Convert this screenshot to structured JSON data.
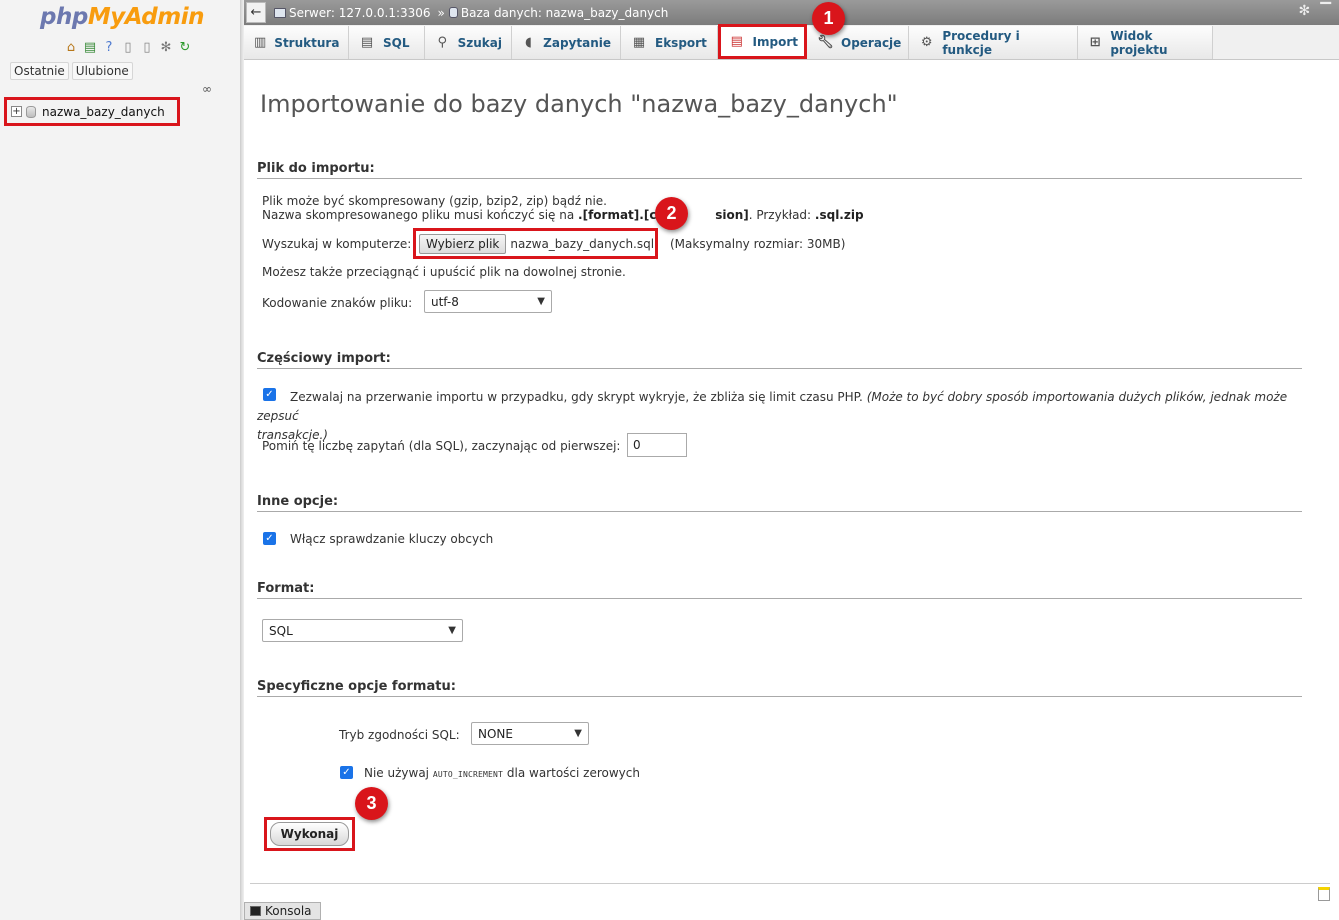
{
  "nav": {
    "logo_php": "php",
    "logo_my": "MyAdmin",
    "tab_recent": "Ostatnie",
    "tab_favorites": "Ulubione",
    "db_item": "nazwa_bazy_danych"
  },
  "topbar": {
    "server": "Serwer: 127.0.0.1:3306",
    "separator": "»",
    "database": "Baza danych: nazwa_bazy_danych"
  },
  "tabs": [
    {
      "label": "Struktura",
      "icon": "structure-icon"
    },
    {
      "label": "SQL",
      "icon": "sql-icon"
    },
    {
      "label": "Szukaj",
      "icon": "search-icon"
    },
    {
      "label": "Zapytanie",
      "icon": "query-icon"
    },
    {
      "label": "Eksport",
      "icon": "export-icon"
    },
    {
      "label": "Import",
      "icon": "import-icon"
    },
    {
      "label": "Operacje",
      "icon": "wrench-icon"
    },
    {
      "label": "Procedury i funkcje",
      "icon": "routines-icon"
    },
    {
      "label": "Widok projektu",
      "icon": "designer-icon"
    }
  ],
  "badges": [
    "1",
    "2",
    "3"
  ],
  "page": {
    "title": "Importowanie do bazy danych \"nazwa_bazy_danych\""
  },
  "file_section": {
    "title": "Plik do importu:",
    "line1": "Plik może być skompresowany (gzip, bzip2, zip) bądź nie.",
    "line2_a": "Nazwa skompresowanego pliku musi kończyć się na ",
    "line2_b": ".[format].[com",
    "line2_c": "sion]",
    "line2_d": ". Przykład: ",
    "line2_e": ".sql.zip",
    "browse_label": "Wyszukaj w komputerze:",
    "choose_button": "Wybierz plik",
    "chosen_file": "nazwa_bazy_danych.sql",
    "max_size": "(Maksymalny rozmiar: 30MB)",
    "dragdrop": "Możesz także przeciągnąć i upuścić plik na dowolnej stronie.",
    "charset_label": "Kodowanie znaków pliku:",
    "charset_value": "utf-8"
  },
  "partial_section": {
    "title": "Częściowy import:",
    "allow_interrupt": "Zezwalaj na przerwanie importu w przypadku, gdy skrypt wykryje, że zbliża się limit czasu PHP.",
    "allow_interrupt_note_1": "(Może to być dobry sposób importowania dużych plików, jednak może zepsuć",
    "allow_interrupt_note_2": "transakcje.)",
    "skip_label": "Pomiń tę liczbę zapytań (dla SQL), zaczynając od pierwszej:",
    "skip_value": "0"
  },
  "other_section": {
    "title": "Inne opcje:",
    "fk_checks": "Włącz sprawdzanie kluczy obcych"
  },
  "format_section": {
    "title": "Format:",
    "value": "SQL"
  },
  "format_options": {
    "title": "Specyficzne opcje formatu:",
    "compat_label": "Tryb zgodności SQL:",
    "compat_value": "NONE",
    "no_auto_a": "Nie używaj ",
    "no_auto_b": "AUTO_INCREMENT",
    "no_auto_c": " dla wartości zerowych"
  },
  "go_button": "Wykonaj",
  "console": "Konsola",
  "colors": {
    "highlight": "#d9151b",
    "tab_text": "#235a81",
    "checkbox": "#1a73e8"
  }
}
